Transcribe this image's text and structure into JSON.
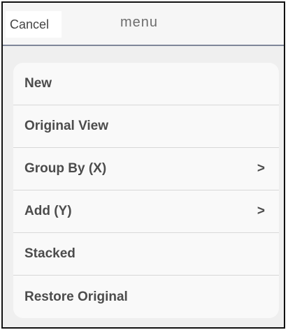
{
  "navbar": {
    "cancel_label": "Cancel",
    "title": "menu"
  },
  "menu": {
    "items": [
      {
        "label": "New",
        "chevron": ""
      },
      {
        "label": "Original View",
        "chevron": ""
      },
      {
        "label": "Group By (X)",
        "chevron": ">"
      },
      {
        "label": "Add (Y)",
        "chevron": ">"
      },
      {
        "label": "Stacked",
        "chevron": ""
      },
      {
        "label": "Restore Original",
        "chevron": ""
      }
    ]
  }
}
